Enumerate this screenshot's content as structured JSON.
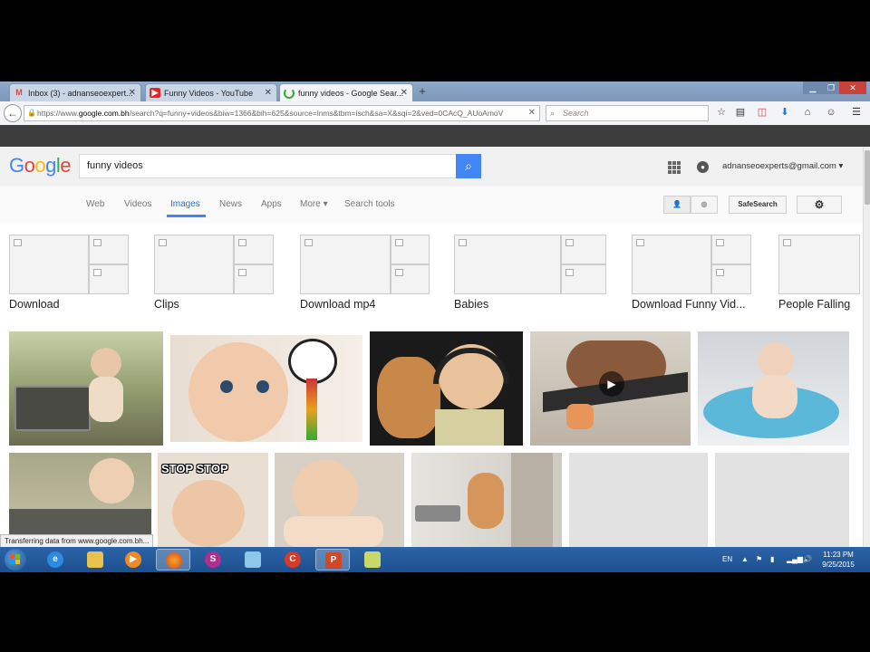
{
  "browser": {
    "tabs": [
      {
        "label": "Inbox (3) - adnanseoexpert...",
        "icon": "gmail-icon",
        "active": false
      },
      {
        "label": "Funny Videos - YouTube",
        "icon": "youtube-icon",
        "active": false
      },
      {
        "label": "funny videos - Google Sear...",
        "icon": "loading-icon",
        "active": true
      }
    ],
    "new_tab": "+",
    "url_prefix": "https://www.",
    "url_domain": "google.com.bh",
    "url_rest": "/search?q=funny+videos&biw=1366&bih=625&source=lnms&tbm=isch&sa=X&sqi=2&ved=0CAcQ_AUoAmoV",
    "search_placeholder": "Search",
    "toolbar_icons": [
      "star-icon",
      "reading-list-icon",
      "pocket-icon",
      "download-icon",
      "home-icon",
      "chat-icon",
      "menu-icon"
    ]
  },
  "google": {
    "logo": "Google",
    "query": "funny videos",
    "account": "adnanseoexperts@gmail.com",
    "nav_tabs": [
      "Web",
      "Videos",
      "Images",
      "News",
      "Apps",
      "More",
      "Search tools"
    ],
    "selected_tab": "Images",
    "safesearch_label": "SafeSearch",
    "related": [
      "Download",
      "Clips",
      "Download mp4",
      "Babies",
      "Download Funny Vid...",
      "People Falling"
    ]
  },
  "status_text": "Transferring data from www.google.com.bh...",
  "thumb_text": {
    "stop_stop": "STOP STOP"
  },
  "taskbar": {
    "apps": [
      "ie-icon",
      "explorer-icon",
      "media-player-icon",
      "firefox-icon",
      "shield-app-icon",
      "notes-icon",
      "ccleaner-icon",
      "powerpoint-icon",
      "sticky-icon"
    ],
    "language": "EN",
    "time": "11:23 PM",
    "date": "9/25/2015"
  },
  "colors": {
    "google_blue": "#4285f4",
    "taskbar": "#1d4f8e"
  }
}
